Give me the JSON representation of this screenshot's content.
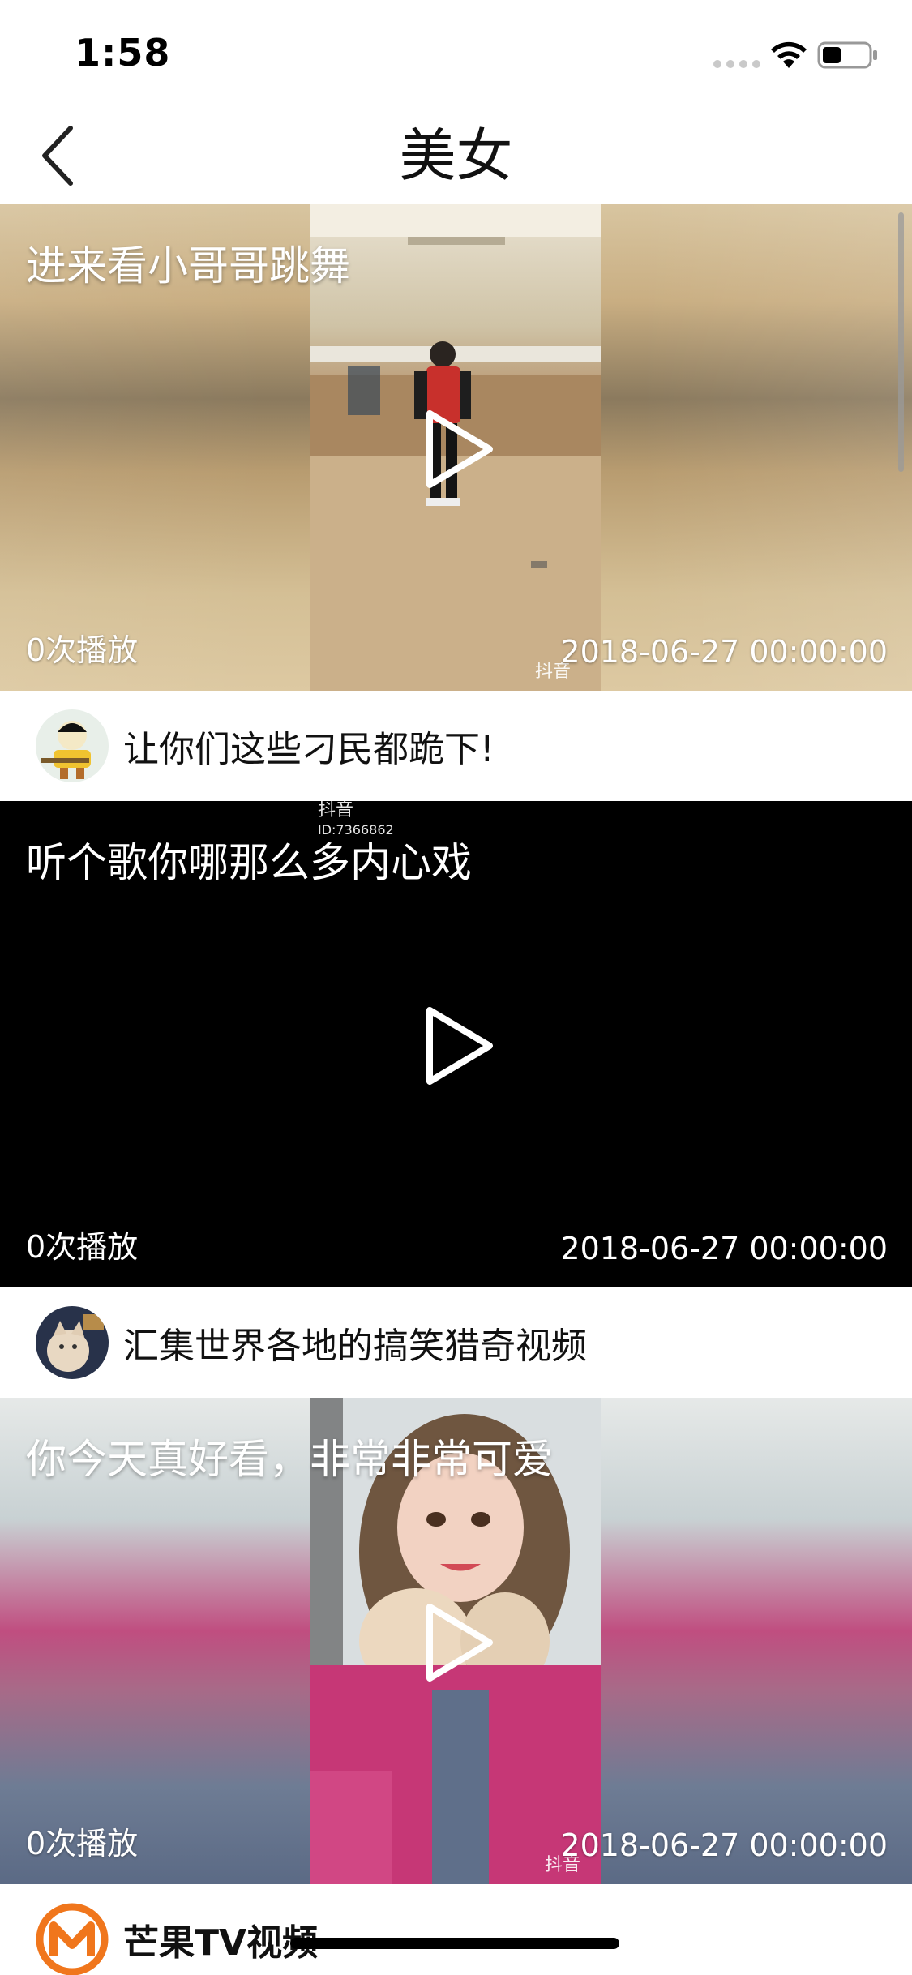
{
  "status_bar": {
    "time": "1:58"
  },
  "nav": {
    "title": "美女"
  },
  "cards": [
    {
      "title": "进来看小哥哥跳舞",
      "plays": "0次播放",
      "date": "2018-06-27 00:00:00",
      "watermark": "抖音",
      "author": "让你们这些刁民都跪下!"
    },
    {
      "title": "听个歌你哪那么多内心戏",
      "plays": "0次播放",
      "date": "2018-06-27 00:00:00",
      "watermark": "抖音",
      "watermark_id": "ID:7366862",
      "author": "汇集世界各地的搞笑猎奇视频"
    },
    {
      "title": "你今天真好看，非常非常可爱",
      "plays": "0次播放",
      "date": "2018-06-27 00:00:00",
      "watermark": "抖音",
      "author": "芒果TV视频"
    }
  ],
  "colors": {
    "accent_orange": "#f0761c"
  }
}
